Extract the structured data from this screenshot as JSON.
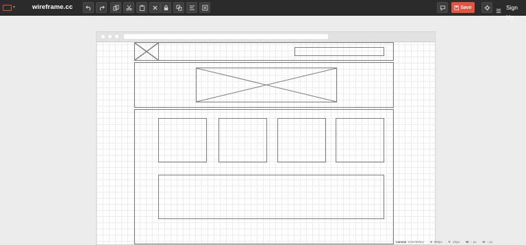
{
  "app": {
    "brand": "wireframe.cc",
    "save_label": "Save",
    "signup_label": "Sign Up",
    "accent_color": "#e8513d"
  },
  "toolbar": {
    "history": [
      "undo-icon",
      "redo-icon"
    ],
    "clipboard": [
      "copy-icon",
      "cut-icon",
      "paste-icon",
      "delete-icon"
    ],
    "arrange": [
      "lock-icon",
      "group-icon",
      "align-icon",
      "stencil-icon"
    ],
    "right": [
      "comment-icon",
      "settings-icon",
      "menu-icon"
    ]
  },
  "status": {
    "canvas_label": "canvas",
    "canvas_value": "1024/830px",
    "x_label": "X",
    "x_value": "809px",
    "y_label": "Y",
    "y_value": "-22px",
    "w_label": "W",
    "w_value": "-- px",
    "h_label": "H",
    "h_value": "-- px"
  }
}
